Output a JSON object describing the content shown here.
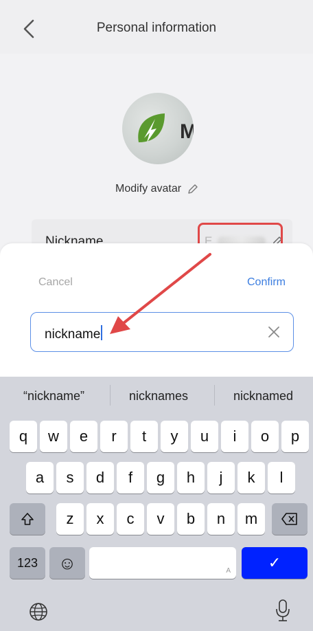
{
  "header": {
    "title": "Personal information"
  },
  "avatar": {
    "logo_text": "M",
    "modify_label": "Modify avatar"
  },
  "nickname_row": {
    "label": "Nickname",
    "value_prefix": "E"
  },
  "sheet": {
    "cancel_label": "Cancel",
    "confirm_label": "Confirm",
    "input_value": "nickname"
  },
  "keyboard": {
    "suggestions": [
      "“nickname”",
      "nicknames",
      "nicknamed"
    ],
    "row1": [
      "q",
      "w",
      "e",
      "r",
      "t",
      "y",
      "u",
      "i",
      "o",
      "p"
    ],
    "row2": [
      "a",
      "s",
      "d",
      "f",
      "g",
      "h",
      "j",
      "k",
      "l"
    ],
    "row3": [
      "z",
      "x",
      "c",
      "v",
      "b",
      "n",
      "m"
    ],
    "numbers_label": "123",
    "emoji_label": "☺",
    "space_hint": "A",
    "return_label": "✓"
  },
  "colors": {
    "accent": "#3b7de0",
    "annotation": "#e04848",
    "return_key": "#0022ff"
  }
}
